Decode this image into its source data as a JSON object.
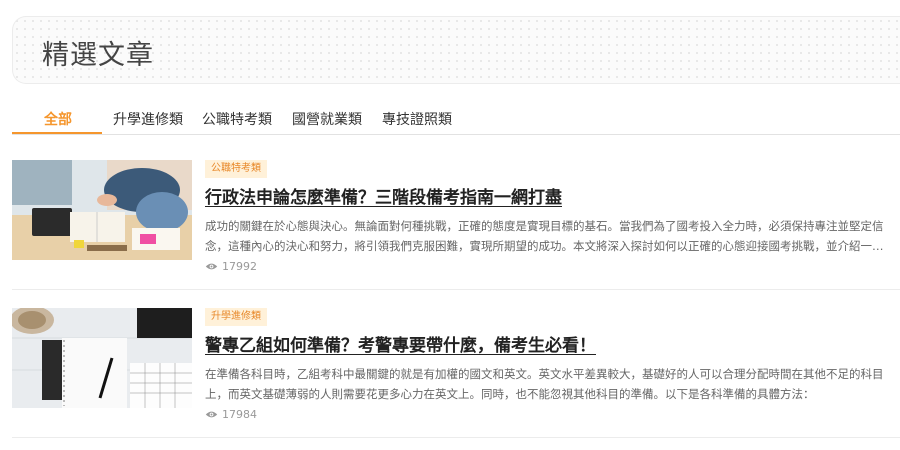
{
  "page": {
    "title": "精選文章"
  },
  "tabs": [
    {
      "label": "全部",
      "active": true
    },
    {
      "label": "升學進修類",
      "active": false
    },
    {
      "label": "公職特考類",
      "active": false
    },
    {
      "label": "國營就業類",
      "active": false
    },
    {
      "label": "專技證照類",
      "active": false
    }
  ],
  "articles": [
    {
      "category": "公職特考類",
      "title": "行政法申論怎麼準備？三階段備考指南一網打盡",
      "excerpt_line1": "成功的關鍵在於心態與決心。無論面對何種挑戰，正確的態度是實現目標的基石。當我們為了國考投入全力時，必須保持專注並堅定信",
      "excerpt_line2": "念，這種內心的決心和努力，將引領我們克服困難，實現所期望的成功。本文將深入探討如何以正確的心態迎接國考挑戰，並介紹一…",
      "views": "17992",
      "thumbnail_icon": "studying-students-photo"
    },
    {
      "category": "升學進修類",
      "title": "警專乙組如何準備？考警專要帶什麼，備考生必看！",
      "excerpt_line1": "在準備各科目時，乙組考科中最關鍵的就是有加權的國文和英文。英文水平差異較大，基礎好的人可以合理分配時間在其他不足的科目",
      "excerpt_line2": "上，而英文基礎薄弱的人則需要花更多心力在英文上。同時，也不能忽視其他科目的準備。以下是各科準備的具體方法：",
      "views": "17984",
      "thumbnail_icon": "notebook-desk-photo"
    }
  ],
  "colors": {
    "accent": "#f5962d",
    "badge_bg": "#fff1d9",
    "badge_text": "#e8892b"
  }
}
